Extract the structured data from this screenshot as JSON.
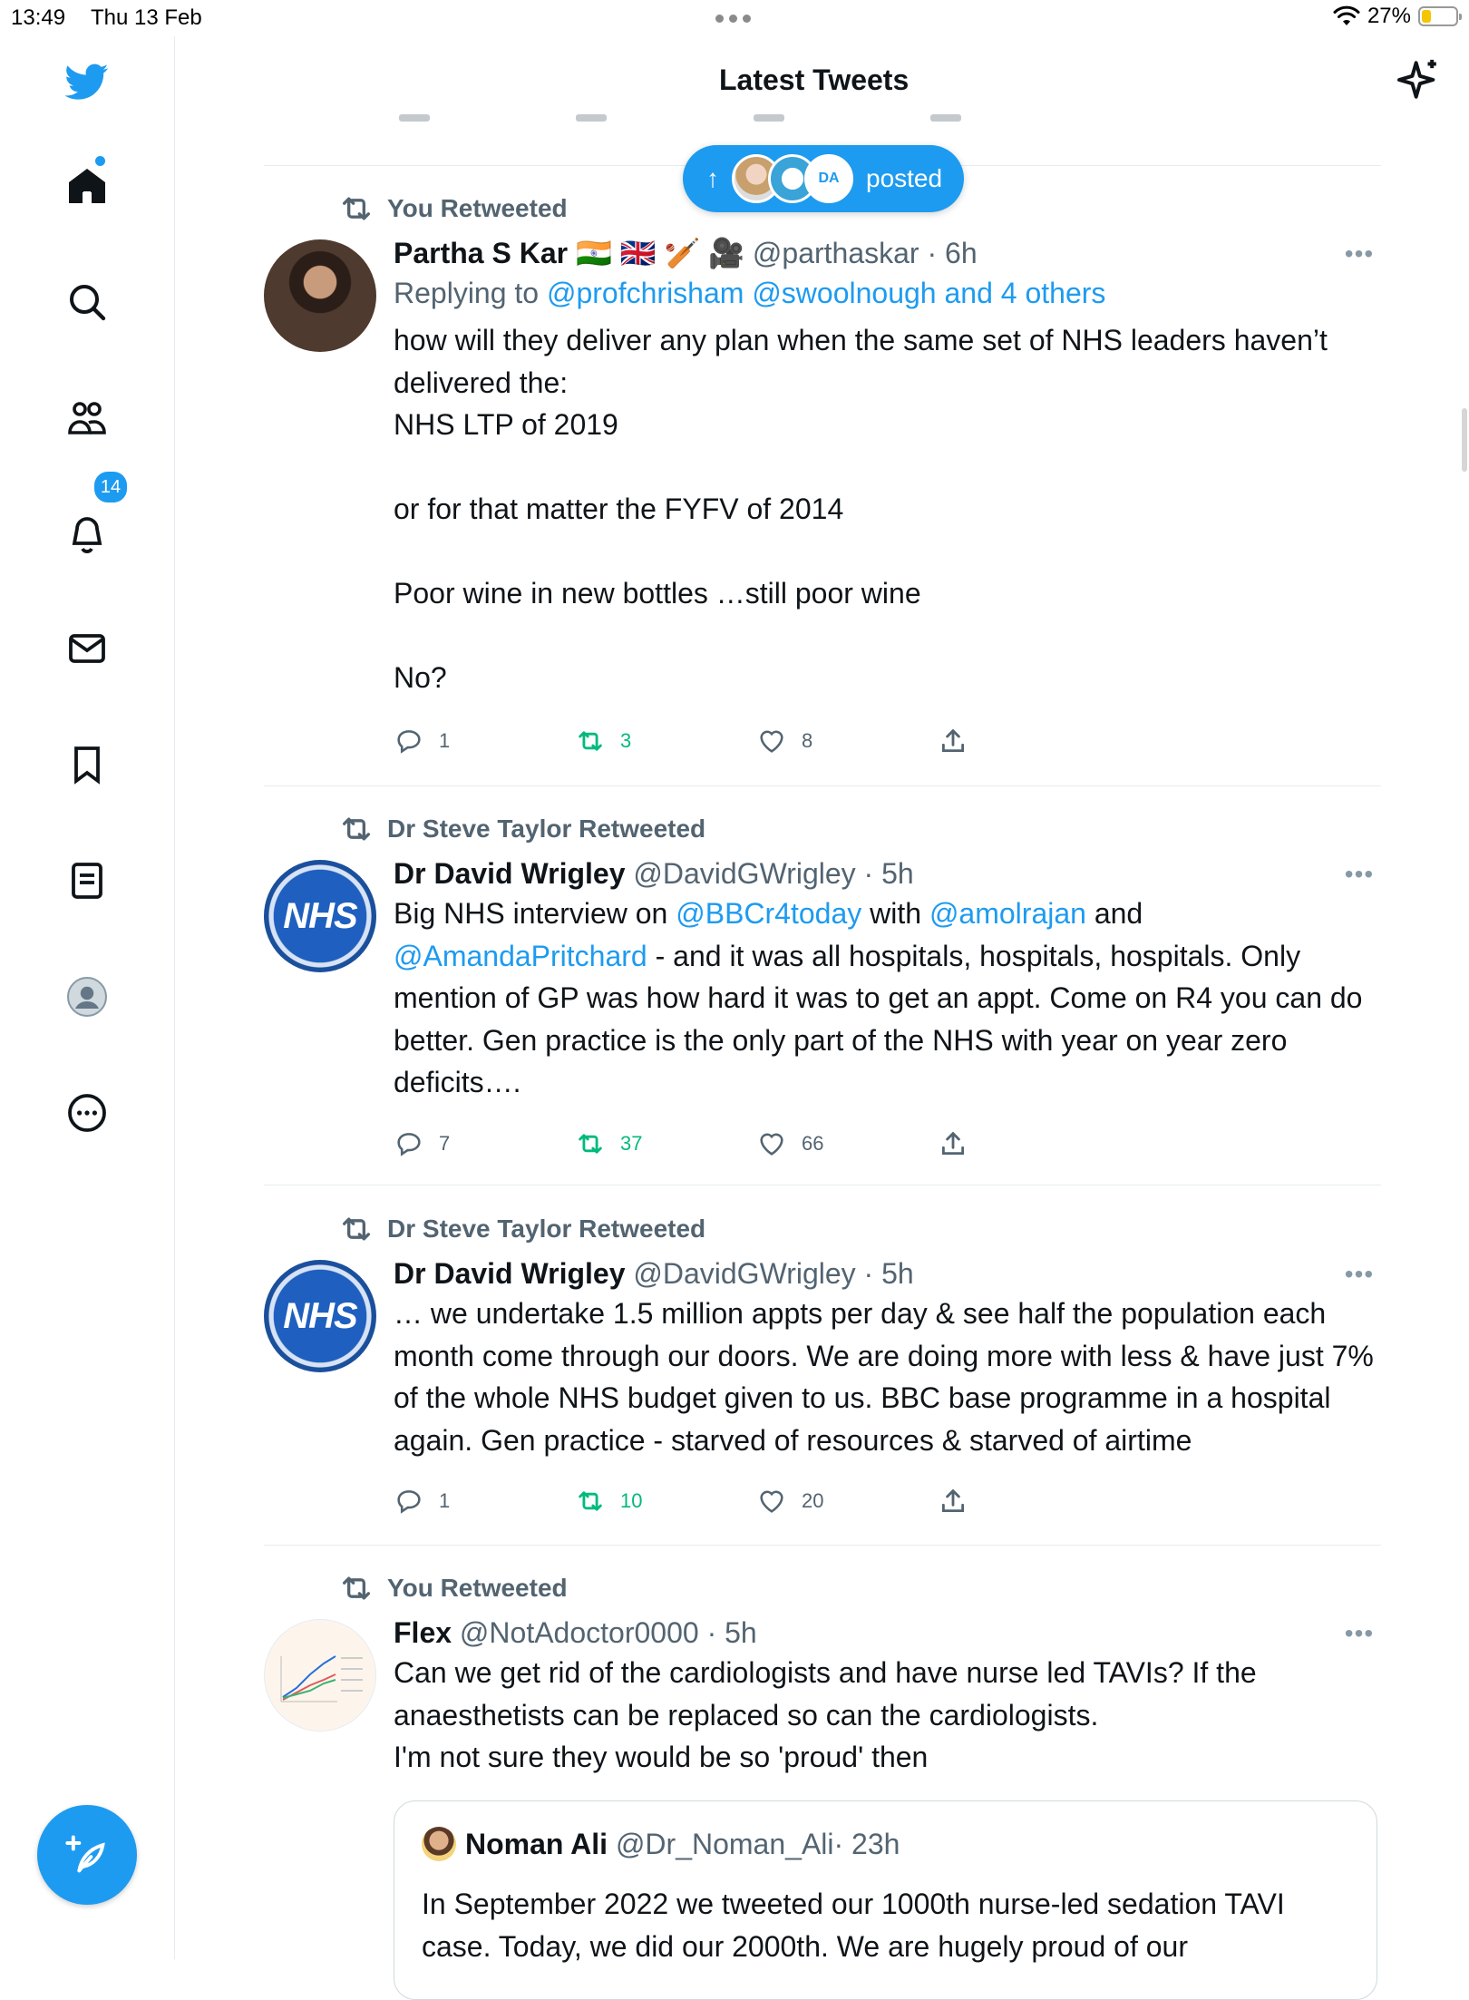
{
  "status_bar": {
    "time": "13:49",
    "date": "Thu 13 Feb",
    "battery": "27%"
  },
  "header": {
    "title": "Latest Tweets"
  },
  "new_posts_pill": {
    "label": "posted",
    "avatar3_text": "DA"
  },
  "nav": {
    "notifications_count": "14"
  },
  "tweets": [
    {
      "context": "You Retweeted",
      "name": "Partha S Kar 🇮🇳 🇬🇧 🏏 🎥",
      "handle": "@parthaskar",
      "time": "· 6h",
      "reply_prefix": "Replying to ",
      "reply_to": "@profchrisham @swoolnough and 4 others",
      "text": "how will they deliver any plan when the same set of NHS leaders haven’t delivered the:\nNHS LTP of 2019\n\nor for that matter the FYFV of 2014\n\nPoor wine in new bottles …still poor wine\n\nNo?",
      "replies": "1",
      "retweets": "3",
      "likes": "8"
    },
    {
      "context": "Dr Steve Taylor Retweeted",
      "name": "Dr David Wrigley",
      "handle": "@DavidGWrigley",
      "time": "· 5h",
      "avatar_text": "NHS",
      "text_parts": [
        "Big NHS interview on ",
        "@BBCr4today",
        " with ",
        "@amolrajan",
        " and ",
        "@AmandaPritchard",
        " - and it was all hospitals, hospitals, hospitals. Only mention of GP was how hard it was to get an appt. Come on R4 you can do better. Gen practice is the only part of the NHS with year on year zero deficits…."
      ],
      "replies": "7",
      "retweets": "37",
      "likes": "66"
    },
    {
      "context": "Dr Steve Taylor Retweeted",
      "name": "Dr David Wrigley",
      "handle": "@DavidGWrigley",
      "time": "· 5h",
      "avatar_text": "NHS",
      "text": "… we undertake 1.5 million appts per day & see half the population each month come through our doors. We are doing more with less & have just 7% of the whole NHS budget given to us. BBC base programme in a hospital again. Gen practice - starved of resources & starved of airtime",
      "replies": "1",
      "retweets": "10",
      "likes": "20"
    },
    {
      "context": "You Retweeted",
      "name": "Flex",
      "handle": "@NotAdoctor0000",
      "time": "· 5h",
      "text": "Can we get rid of the cardiologists and have nurse led TAVIs? If the anaesthetists can be replaced so can the cardiologists.\nI'm not sure they would be so 'proud' then",
      "quote": {
        "name": "Noman Ali",
        "handle": "@Dr_Noman_Ali",
        "time": "· 23h",
        "text": "In September 2022 we tweeted our 1000th nurse-led sedation TAVI case. Today, we did our 2000th. We are hugely proud of our"
      }
    }
  ],
  "colors": {
    "accent": "#1d9bf0",
    "retweet_green": "#00ba7c",
    "muted": "#536471"
  }
}
